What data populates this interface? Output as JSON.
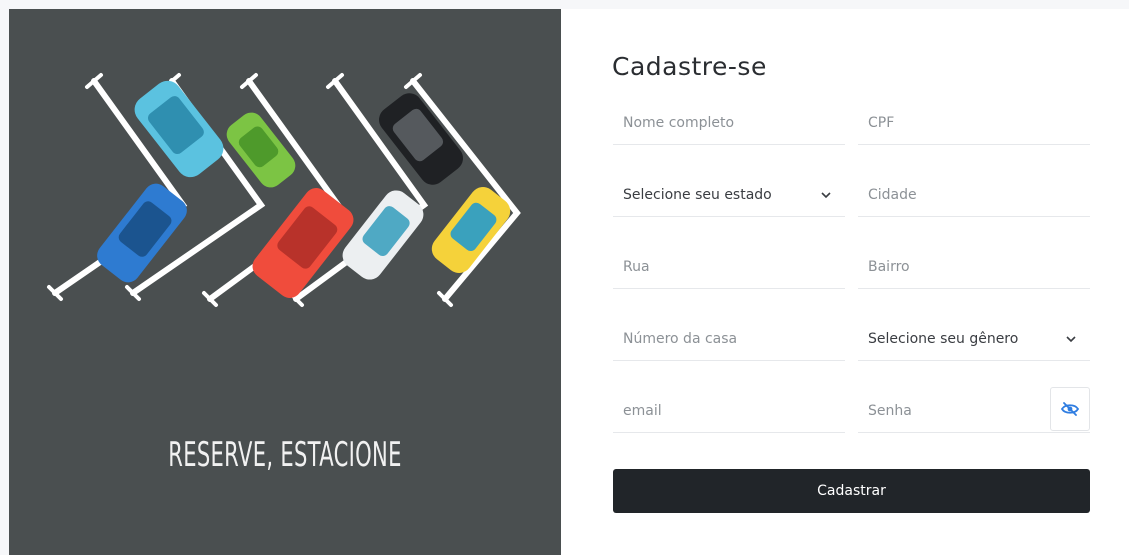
{
  "hero": {
    "tagline": "RESERVE, ESTACIONE",
    "background_color": "#4a4f50",
    "car_colors": [
      "#5bc2e0",
      "#7cc444",
      "#1f2124",
      "#2e7bd1",
      "#f04c3c",
      "#eceff1",
      "#f5d23a"
    ]
  },
  "form": {
    "title": "Cadastre-se",
    "fields": {
      "full_name": {
        "placeholder": "Nome completo"
      },
      "cpf": {
        "placeholder": "CPF"
      },
      "state": {
        "selected": "Selecione seu estado"
      },
      "city": {
        "placeholder": "Cidade"
      },
      "street": {
        "placeholder": "Rua"
      },
      "district": {
        "placeholder": "Bairro"
      },
      "house_number": {
        "placeholder": "Número da casa"
      },
      "gender": {
        "selected": "Selecione seu gênero"
      },
      "email": {
        "placeholder": "email"
      },
      "password": {
        "placeholder": "Senha"
      }
    },
    "password_toggle_icon": "eye-slash-icon",
    "submit_label": "Cadastrar",
    "accent_color": "#2f7de1",
    "button_color": "#212529"
  }
}
